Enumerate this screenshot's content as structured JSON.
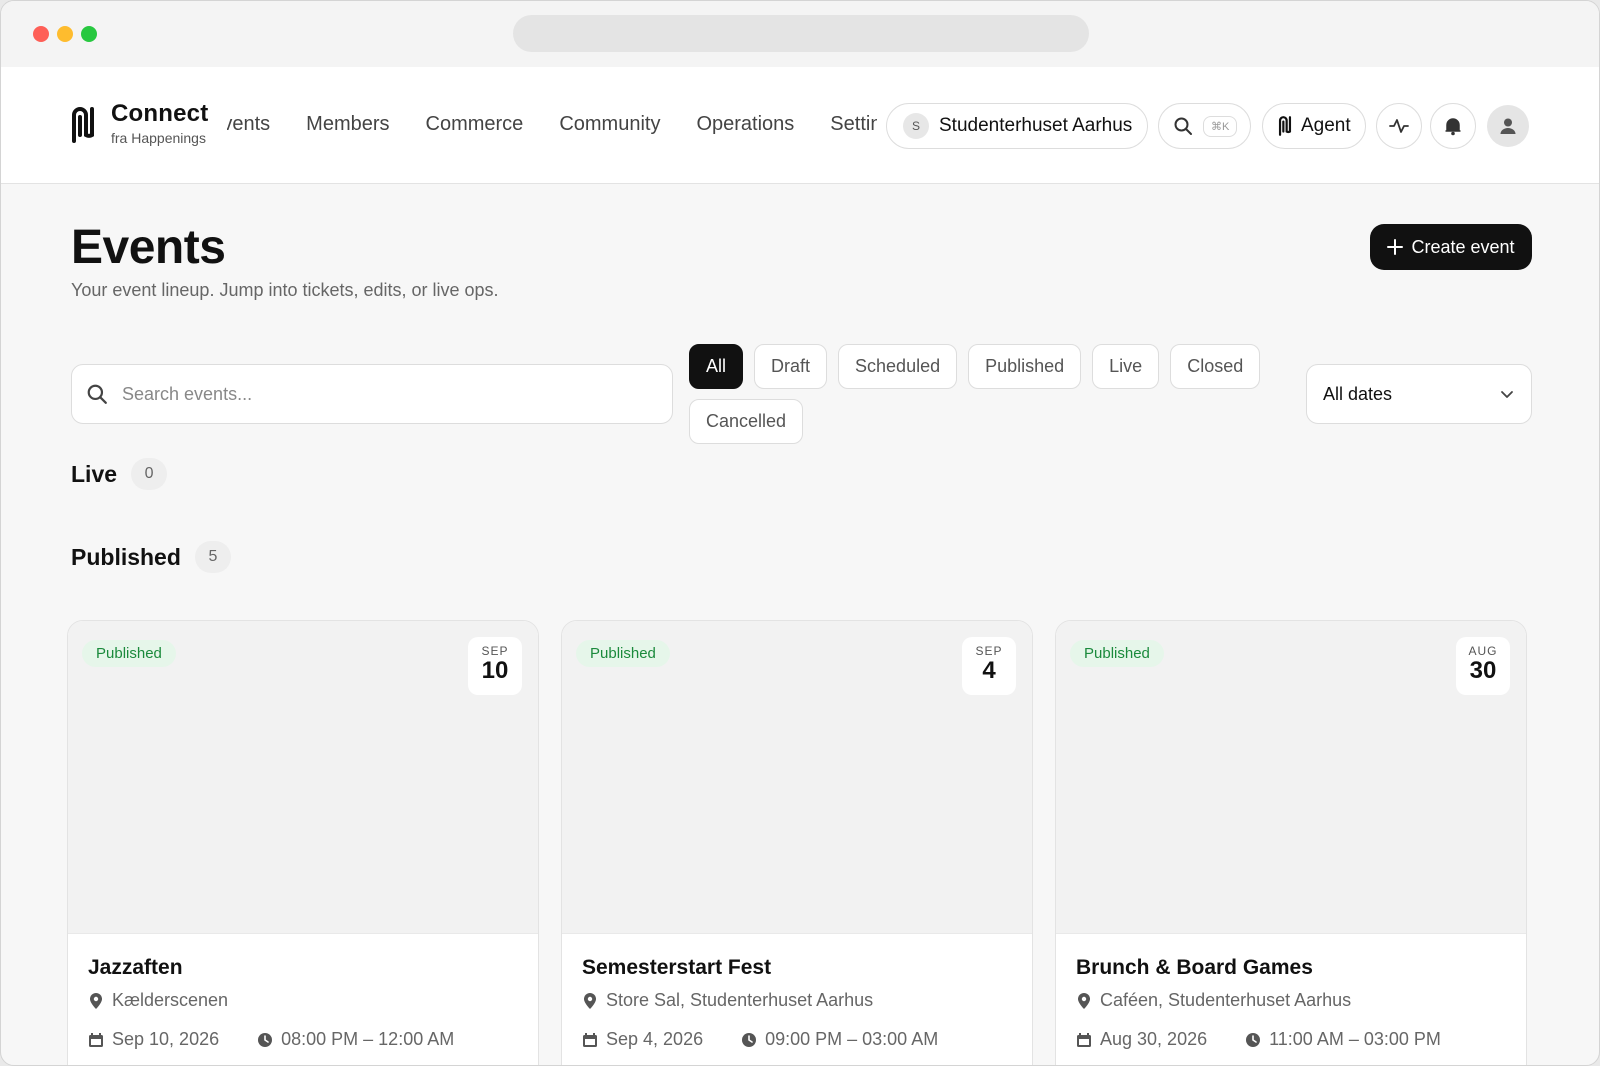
{
  "brand": {
    "name": "Connect",
    "sub": "fra Happenings"
  },
  "nav": {
    "links": [
      "Events",
      "Members",
      "Commerce",
      "Community",
      "Operations",
      "Settings"
    ]
  },
  "org": {
    "initial": "S",
    "name": "Studenterhuset Aarhus"
  },
  "search_shortcut": "⌘K",
  "agent_label": "Agent",
  "page": {
    "title": "Events",
    "subtitle": "Your event lineup. Jump into tickets, edits, or live ops.",
    "create_label": "Create event"
  },
  "search": {
    "placeholder": "Search events..."
  },
  "filters": [
    "All",
    "Draft",
    "Scheduled",
    "Published",
    "Live",
    "Closed",
    "Cancelled"
  ],
  "active_filter": "All",
  "date_filter": "All dates",
  "sections": {
    "live": {
      "title": "Live",
      "count": "0"
    },
    "published": {
      "title": "Published",
      "count": "5"
    }
  },
  "events": [
    {
      "badge": "Published",
      "month": "SEP",
      "day": "10",
      "title": "Jazzaften",
      "location": "Kælderscenen",
      "date": "Sep 10, 2026",
      "time": "08:00 PM – 12:00 AM"
    },
    {
      "badge": "Published",
      "month": "SEP",
      "day": "4",
      "title": "Semesterstart Fest",
      "location": "Store Sal, Studenterhuset Aarhus",
      "date": "Sep 4, 2026",
      "time": "09:00 PM – 03:00 AM"
    },
    {
      "badge": "Published",
      "month": "AUG",
      "day": "30",
      "title": "Brunch & Board Games",
      "location": "Caféen, Studenterhuset Aarhus",
      "date": "Aug 30, 2026",
      "time": "11:00 AM – 03:00 PM"
    }
  ],
  "colors": {
    "accent": "#111111",
    "published_badge_bg": "#e6f6ea",
    "published_badge_text": "#1b8a3c"
  }
}
